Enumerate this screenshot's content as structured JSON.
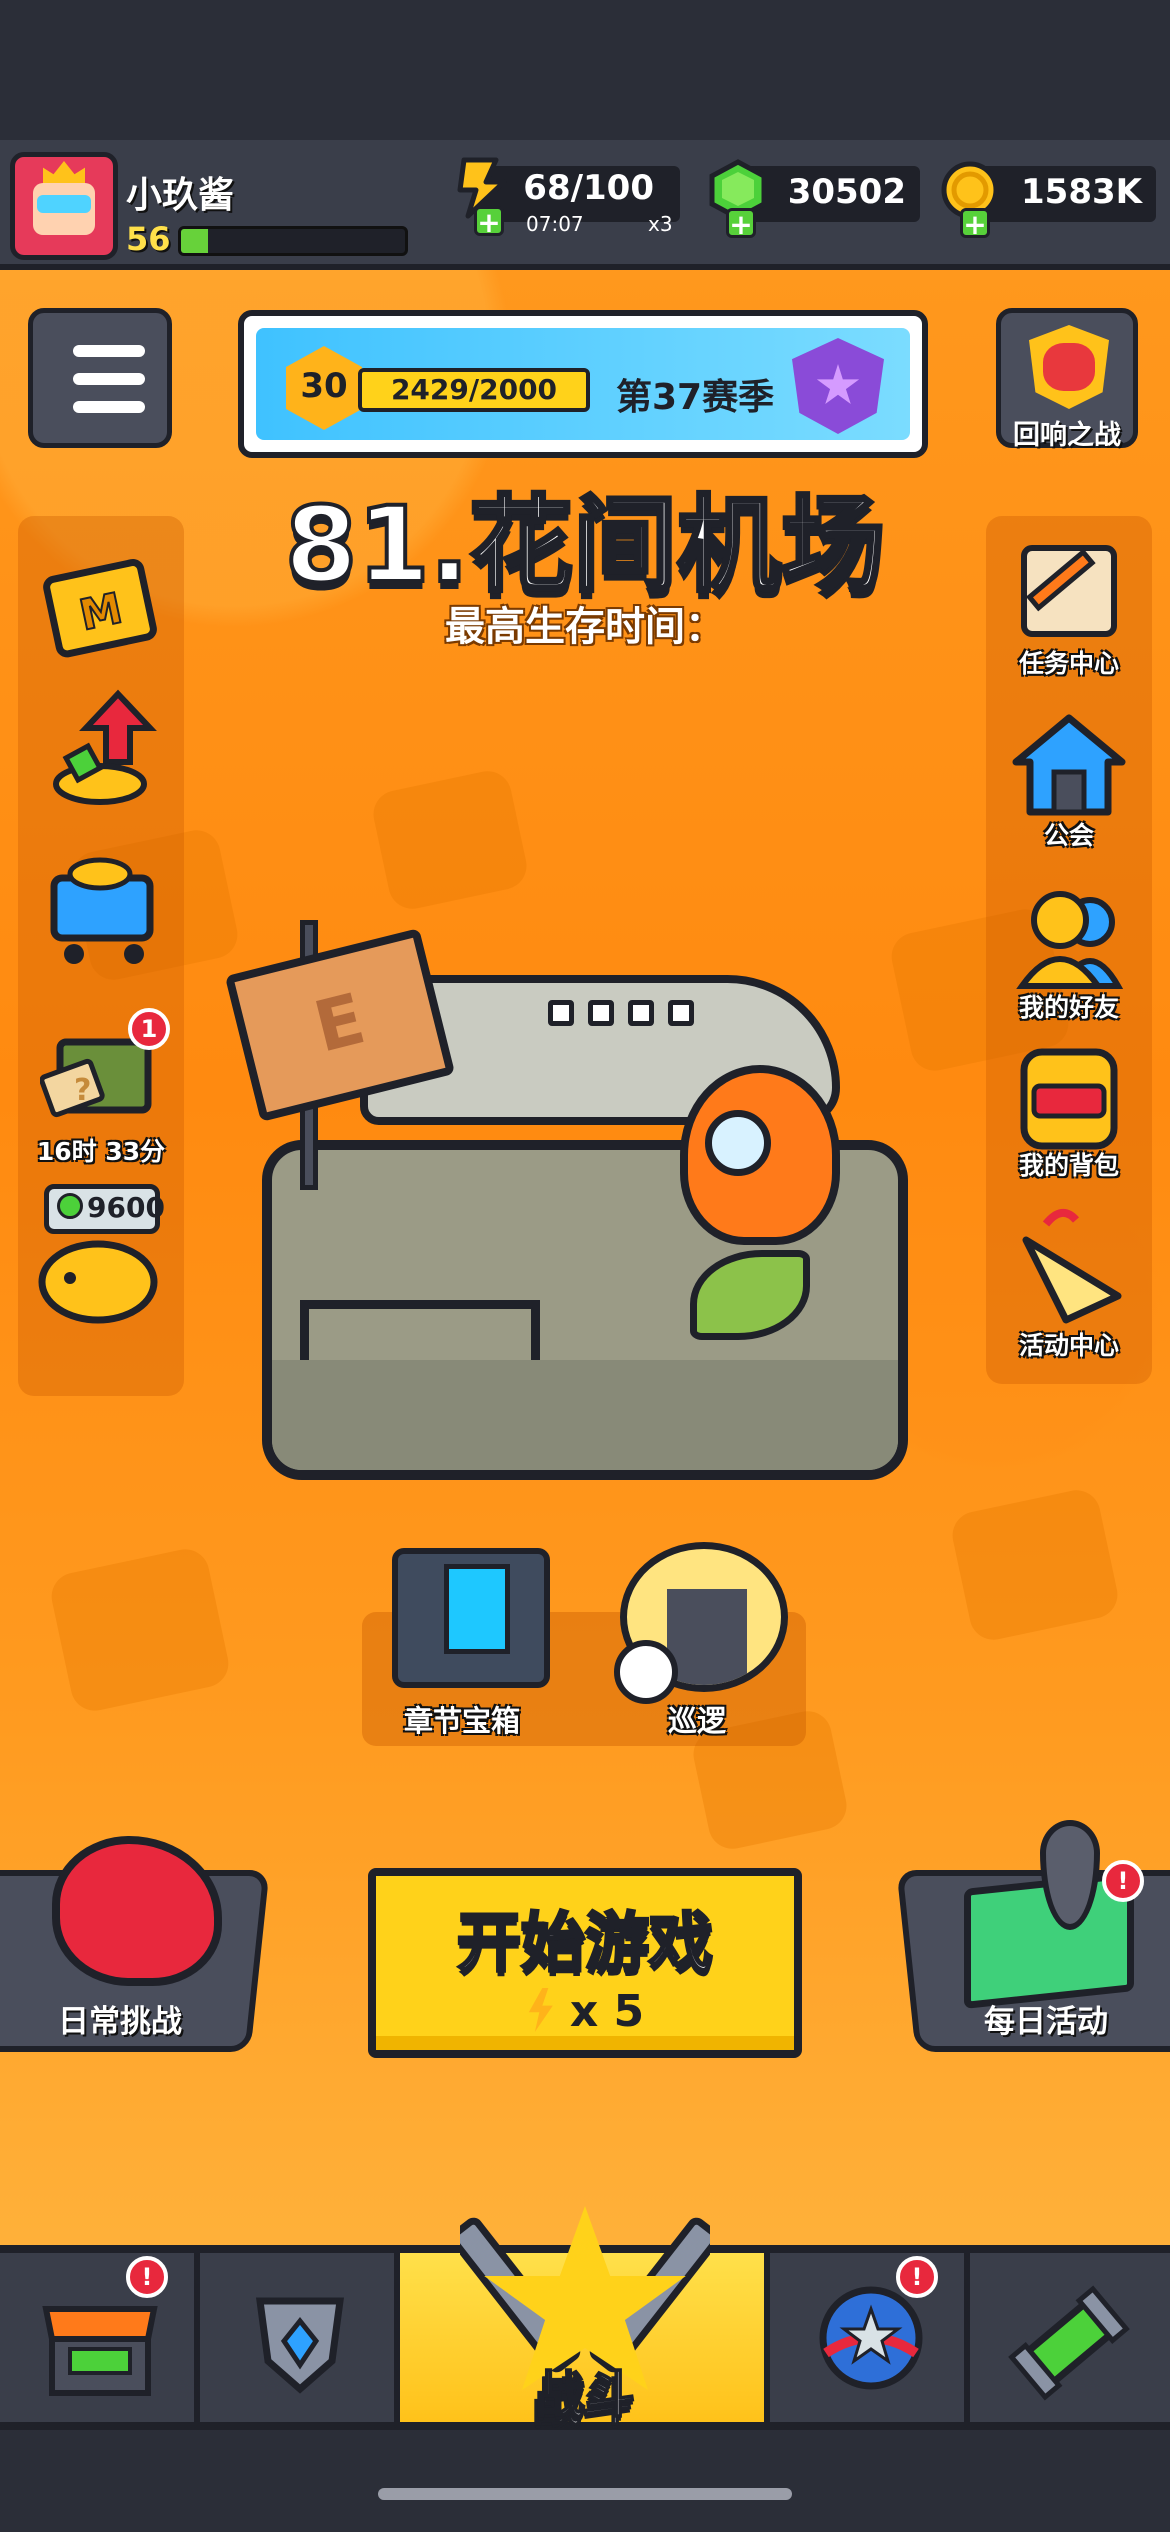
{
  "player": {
    "name": "小玖酱",
    "level": "56",
    "xp_fraction": 0.12
  },
  "resources": {
    "energy": {
      "value": "68/100",
      "timer": "07:07",
      "multiplier": "x3",
      "icon": "energy-icon"
    },
    "gems": {
      "value": "30502",
      "icon": "gem-icon"
    },
    "coins": {
      "value": "1583K",
      "icon": "coin-icon"
    }
  },
  "season": {
    "level": "30",
    "progress": "2429/2000",
    "name": "第37赛季"
  },
  "echo_battle": {
    "label": "回响之战"
  },
  "stage": {
    "title": "81.花间机场",
    "best_survival_label": "最高生存时间："
  },
  "left_menu": {
    "timer_label": "16时 33分",
    "timer_badge": "1",
    "piggy_value": "9600"
  },
  "right_menu": [
    {
      "label": "任务中心",
      "icon": "quest-scroll-icon"
    },
    {
      "label": "公会",
      "icon": "guild-house-icon"
    },
    {
      "label": "我的好友",
      "icon": "friends-icon"
    },
    {
      "label": "我的背包",
      "icon": "backpack-icon"
    },
    {
      "label": "活动中心",
      "icon": "party-horn-icon"
    }
  ],
  "chests": {
    "chapter_chest": "章节宝箱",
    "patrol": "巡逻"
  },
  "actions": {
    "daily_challenge": "日常挑战",
    "daily_activity": "每日活动",
    "start_game": "开始游戏",
    "start_cost": "x 5"
  },
  "nav": {
    "battle_label": "战斗",
    "badge": "!"
  },
  "colors": {
    "accent": "#ff9a1f",
    "button": "#ffd21a",
    "dark": "#1f2129",
    "badge": "#e8283d"
  }
}
